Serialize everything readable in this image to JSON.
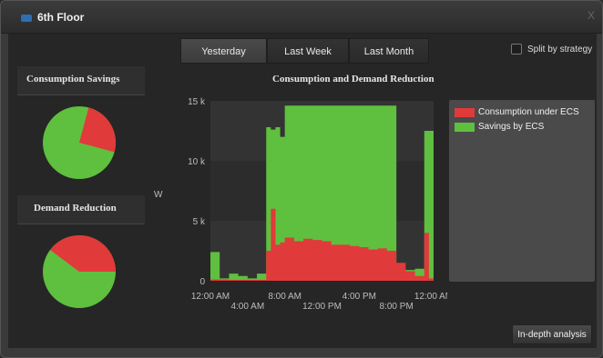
{
  "window": {
    "title": "6th Floor",
    "close_label": "X"
  },
  "tabs": [
    {
      "label": "Yesterday",
      "active": true
    },
    {
      "label": "Last Week",
      "active": false
    },
    {
      "label": "Last Month",
      "active": false
    }
  ],
  "split": {
    "label": "Split by strategy",
    "checked": false
  },
  "sections": {
    "consumption_savings": "Consumption Savings",
    "demand_reduction": "Demand Reduction",
    "main_chart": "Consumption and Demand Reduction"
  },
  "legend": {
    "items": [
      {
        "label": "Consumption under ECS",
        "color": "#e03a3a"
      },
      {
        "label": "Savings by ECS",
        "color": "#5fbf3f"
      }
    ]
  },
  "buttons": {
    "in_depth": "In-depth analysis"
  },
  "chart_data": [
    {
      "type": "pie",
      "labels": [
        "Consumption under ECS",
        "Savings by ECS"
      ],
      "values": [
        0.18,
        0.82
      ],
      "colors": [
        "#e03a3a",
        "#5fbf3f"
      ]
    },
    {
      "type": "pie",
      "labels": [
        "Consumption under ECS",
        "Savings by ECS"
      ],
      "values": [
        0.3,
        0.7
      ],
      "colors": [
        "#e03a3a",
        "#5fbf3f"
      ]
    },
    {
      "type": "area",
      "title": "Consumption and Demand Reduction",
      "ylabel": "W",
      "ylim": [
        0,
        15000
      ],
      "yticks": [
        "0",
        "5 k",
        "10 k",
        "15 k"
      ],
      "xticks_upper": [
        "12:00 AM",
        "8:00 AM",
        "4:00 PM",
        "12:00 AM"
      ],
      "xticks_lower": [
        "4:00 AM",
        "12:00 PM",
        "8:00 PM"
      ],
      "x_hours": [
        0,
        0.5,
        1,
        1.5,
        2,
        3,
        4,
        5,
        6,
        6.5,
        7,
        7.5,
        8,
        9,
        10,
        11,
        12,
        13,
        14,
        15,
        16,
        17,
        18,
        19,
        20,
        21,
        22,
        23,
        23.5,
        24
      ],
      "series": [
        {
          "name": "Consumption under ECS",
          "color": "#e03a3a",
          "values": [
            100,
            100,
            100,
            100,
            80,
            80,
            80,
            80,
            2500,
            6000,
            3000,
            3200,
            3600,
            3300,
            3500,
            3400,
            3300,
            3000,
            3000,
            2900,
            2800,
            2600,
            2700,
            2500,
            1500,
            800,
            400,
            4000,
            200,
            200
          ]
        },
        {
          "name": "Savings by ECS",
          "color": "#5fbf3f",
          "values": [
            2400,
            2400,
            200,
            200,
            600,
            400,
            200,
            600,
            12800,
            12600,
            12800,
            12000,
            14600,
            14600,
            14600,
            14600,
            14600,
            14600,
            14600,
            14600,
            14600,
            14600,
            14600,
            14600,
            1000,
            900,
            1000,
            12500,
            12500,
            12500
          ]
        }
      ]
    }
  ]
}
